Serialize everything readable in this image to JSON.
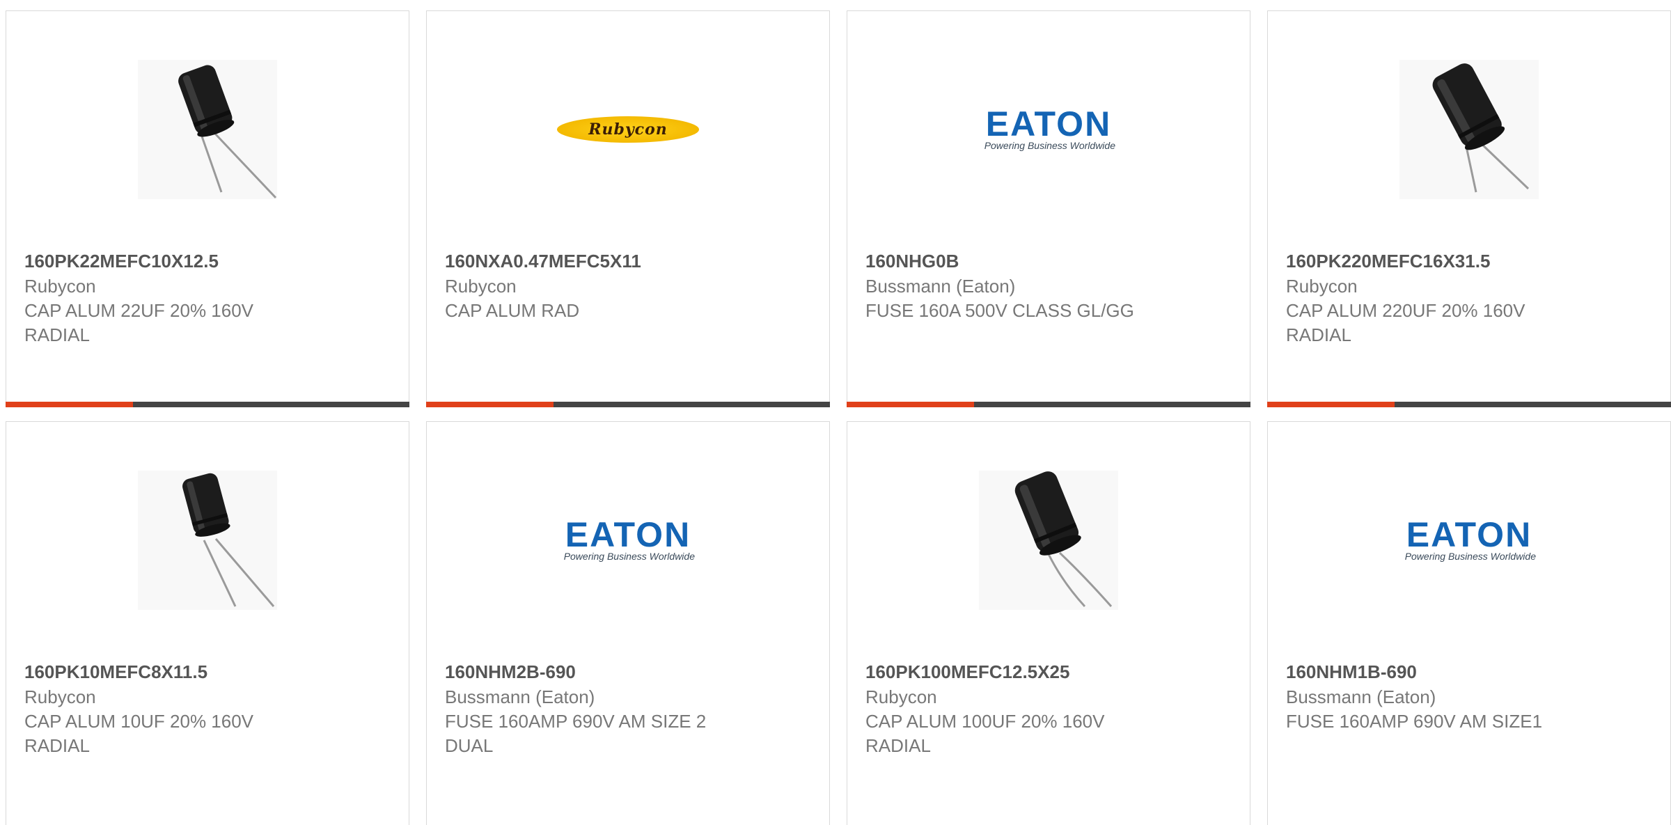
{
  "colors": {
    "accent": "#e0401a",
    "bar": "#444444",
    "eaton_blue": "#1464b4",
    "rubycon_gold": "#f3b800"
  },
  "products": [
    {
      "part_number": "160PK22MEFC10X12.5",
      "manufacturer": "Rubycon",
      "description_line1": "CAP ALUM 22UF 20% 160V",
      "description_line2": "RADIAL",
      "image": "capacitor-photo"
    },
    {
      "part_number": "160NXA0.47MEFC5X11",
      "manufacturer": "Rubycon",
      "description_line1": "CAP ALUM RAD",
      "description_line2": "",
      "image": "rubycon-logo",
      "logo_text": "Rubycon"
    },
    {
      "part_number": "160NHG0B",
      "manufacturer": "Bussmann (Eaton)",
      "description_line1": "FUSE 160A 500V CLASS GL/GG",
      "description_line2": "",
      "image": "eaton-logo",
      "logo_text": "EATON",
      "logo_tagline": "Powering Business Worldwide"
    },
    {
      "part_number": "160PK220MEFC16X31.5",
      "manufacturer": "Rubycon",
      "description_line1": "CAP ALUM 220UF 20% 160V",
      "description_line2": "RADIAL",
      "image": "capacitor-photo"
    },
    {
      "part_number": "160PK10MEFC8X11.5",
      "manufacturer": "Rubycon",
      "description_line1": "CAP ALUM 10UF 20% 160V",
      "description_line2": "RADIAL",
      "image": "capacitor-photo"
    },
    {
      "part_number": "160NHM2B-690",
      "manufacturer": "Bussmann (Eaton)",
      "description_line1": "FUSE 160AMP 690V AM SIZE 2",
      "description_line2": "DUAL",
      "image": "eaton-logo",
      "logo_text": "EATON",
      "logo_tagline": "Powering Business Worldwide"
    },
    {
      "part_number": "160PK100MEFC12.5X25",
      "manufacturer": "Rubycon",
      "description_line1": "CAP ALUM 100UF 20% 160V",
      "description_line2": "RADIAL",
      "image": "capacitor-photo"
    },
    {
      "part_number": "160NHM1B-690",
      "manufacturer": "Bussmann (Eaton)",
      "description_line1": "FUSE 160AMP 690V AM SIZE1",
      "description_line2": "",
      "image": "eaton-logo",
      "logo_text": "EATON",
      "logo_tagline": "Powering Business Worldwide"
    }
  ]
}
